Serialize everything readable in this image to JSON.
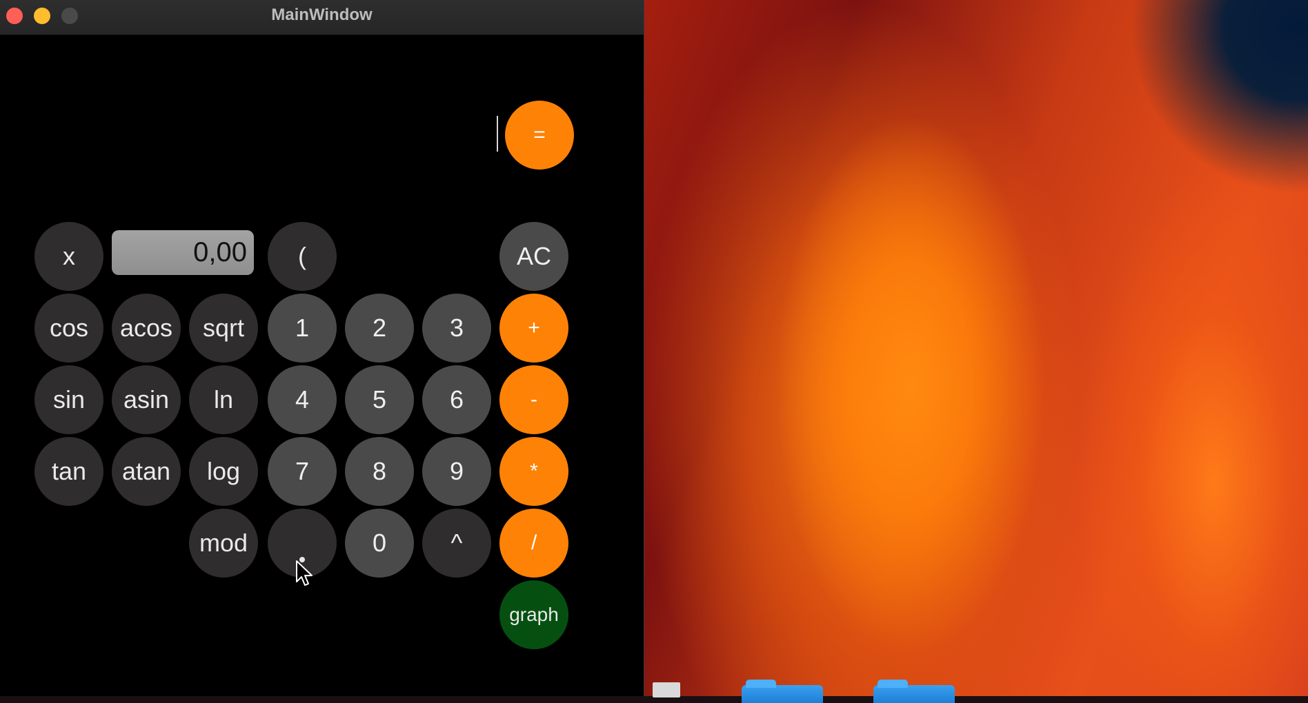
{
  "window": {
    "title": "MainWindow"
  },
  "display": {
    "value": "0,00"
  },
  "buttons": {
    "equals": "=",
    "x": "x",
    "open_paren": "(",
    "ac": "AC",
    "cos": "cos",
    "acos": "acos",
    "sqrt": "sqrt",
    "one": "1",
    "two": "2",
    "three": "3",
    "plus": "+",
    "sin": "sin",
    "asin": "asin",
    "ln": "ln",
    "four": "4",
    "five": "5",
    "six": "6",
    "minus": "-",
    "tan": "tan",
    "atan": "atan",
    "log": "log",
    "seven": "7",
    "eight": "8",
    "nine": "9",
    "multiply": "*",
    "mod": "mod",
    "zero": "0",
    "power": "^",
    "divide": "/",
    "graph": "graph"
  },
  "colors": {
    "operator": "#fe8206",
    "function": "#2f2d2d",
    "digit": "#4b4a4b",
    "graph": "#055011",
    "close": "#fe5f57",
    "minimize": "#febc2e"
  },
  "icons": [
    "close-icon",
    "minimize-icon",
    "zoom-icon",
    "mouse-pointer-icon",
    "folder-icon"
  ]
}
